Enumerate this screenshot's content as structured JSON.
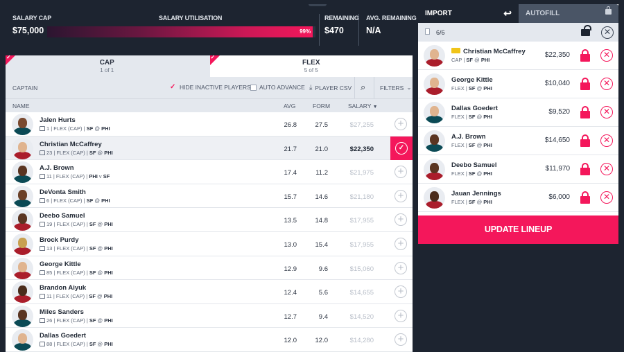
{
  "header": {
    "salary_cap_label": "SALARY CAP",
    "salary_cap_value": "$75,000",
    "utilisation_label": "SALARY UTILISATION",
    "utilisation_pct_text": "99%",
    "utilisation_fraction": 0.99,
    "remaining_label": "REMAINING",
    "remaining_value": "$470",
    "avg_remaining_label": "AVG. REMAINING",
    "avg_remaining_value": "N/A"
  },
  "tabs": {
    "cap": {
      "title": "CAP",
      "sub": "1 of 1"
    },
    "flex": {
      "title": "FLEX",
      "sub": "5 of 5"
    }
  },
  "toolbar": {
    "captain": "CAPTAIN",
    "hide_inactive": "HIDE INACTIVE PLAYERS",
    "auto_advance": "AUTO ADVANCE",
    "player_csv": "PLAYER CSV",
    "filters": "FILTERS"
  },
  "columns": {
    "name": "NAME",
    "avg": "AVG",
    "form": "FORM",
    "salary": "SALARY"
  },
  "players": [
    {
      "name": "Jalen Hurts",
      "num": "1",
      "pos": "FLEX (CAP)",
      "team": "SF",
      "at": "@",
      "opp": "PHI",
      "avg": "26.8",
      "form": "27.5",
      "salary": "$27,255",
      "selected": false,
      "jersey": "#0b4a55",
      "skin": "#7a4a30"
    },
    {
      "name": "Christian McCaffrey",
      "num": "23",
      "pos": "FLEX (CAP)",
      "team": "SF",
      "at": "@",
      "opp": "PHI",
      "avg": "21.7",
      "form": "21.0",
      "salary": "$22,350",
      "selected": true,
      "jersey": "#aa1d2b",
      "skin": "#e0b48f"
    },
    {
      "name": "A.J. Brown",
      "num": "11",
      "pos": "FLEX (CAP)",
      "team": "PHI",
      "at": "v",
      "opp": "SF",
      "avg": "17.4",
      "form": "11.2",
      "salary": "$21,975",
      "selected": false,
      "jersey": "#0b4a55",
      "skin": "#5a3522"
    },
    {
      "name": "DeVonta Smith",
      "num": "6",
      "pos": "FLEX (CAP)",
      "team": "SF",
      "at": "@",
      "opp": "PHI",
      "avg": "15.7",
      "form": "14.6",
      "salary": "$21,180",
      "selected": false,
      "jersey": "#0b4a55",
      "skin": "#6b4028"
    },
    {
      "name": "Deebo Samuel",
      "num": "19",
      "pos": "FLEX (CAP)",
      "team": "SF",
      "at": "@",
      "opp": "PHI",
      "avg": "13.5",
      "form": "14.8",
      "salary": "$17,955",
      "selected": false,
      "jersey": "#aa1d2b",
      "skin": "#5a3522"
    },
    {
      "name": "Brock Purdy",
      "num": "13",
      "pos": "FLEX (CAP)",
      "team": "SF",
      "at": "@",
      "opp": "PHI",
      "avg": "13.0",
      "form": "15.4",
      "salary": "$17,955",
      "selected": false,
      "jersey": "#aa1d2b",
      "skin": "#c8a050"
    },
    {
      "name": "George Kittle",
      "num": "85",
      "pos": "FLEX (CAP)",
      "team": "SF",
      "at": "@",
      "opp": "PHI",
      "avg": "12.9",
      "form": "9.6",
      "salary": "$15,060",
      "selected": false,
      "jersey": "#aa1d2b",
      "skin": "#e0b48f"
    },
    {
      "name": "Brandon Aiyuk",
      "num": "11",
      "pos": "FLEX (CAP)",
      "team": "SF",
      "at": "@",
      "opp": "PHI",
      "avg": "12.4",
      "form": "5.6",
      "salary": "$14,655",
      "selected": false,
      "jersey": "#aa1d2b",
      "skin": "#4a2c1c"
    },
    {
      "name": "Miles Sanders",
      "num": "26",
      "pos": "FLEX (CAP)",
      "team": "SF",
      "at": "@",
      "opp": "PHI",
      "avg": "12.7",
      "form": "9.4",
      "salary": "$14,520",
      "selected": false,
      "jersey": "#0b4a55",
      "skin": "#5a3522"
    },
    {
      "name": "Dallas Goedert",
      "num": "88",
      "pos": "FLEX (CAP)",
      "team": "SF",
      "at": "@",
      "opp": "PHI",
      "avg": "12.0",
      "form": "12.0",
      "salary": "$14,280",
      "selected": false,
      "jersey": "#0b4a55",
      "skin": "#e0b48f"
    }
  ],
  "right": {
    "import_label": "IMPORT",
    "autofill_label": "AUTOFILL",
    "count": "6/6",
    "lineup": [
      {
        "name": "Christian McCaffrey",
        "slot": "CAP",
        "team": "SF",
        "at": "@",
        "opp": "PHI",
        "salary": "$22,350",
        "captain": true,
        "jersey": "#aa1d2b",
        "skin": "#e0b48f"
      },
      {
        "name": "George Kittle",
        "slot": "FLEX",
        "team": "SF",
        "at": "@",
        "opp": "PHI",
        "salary": "$10,040",
        "captain": false,
        "jersey": "#aa1d2b",
        "skin": "#e0b48f"
      },
      {
        "name": "Dallas Goedert",
        "slot": "FLEX",
        "team": "SF",
        "at": "@",
        "opp": "PHI",
        "salary": "$9,520",
        "captain": false,
        "jersey": "#0b4a55",
        "skin": "#e0b48f"
      },
      {
        "name": "A.J. Brown",
        "slot": "FLEX",
        "team": "SF",
        "at": "@",
        "opp": "PHI",
        "salary": "$14,650",
        "captain": false,
        "jersey": "#0b4a55",
        "skin": "#5a3522"
      },
      {
        "name": "Deebo Samuel",
        "slot": "FLEX",
        "team": "SF",
        "at": "@",
        "opp": "PHI",
        "salary": "$11,970",
        "captain": false,
        "jersey": "#aa1d2b",
        "skin": "#5a3522"
      },
      {
        "name": "Jauan Jennings",
        "slot": "FLEX",
        "team": "SF",
        "at": "@",
        "opp": "PHI",
        "salary": "$6,000",
        "captain": false,
        "jersey": "#aa1d2b",
        "skin": "#4a2c1c"
      }
    ],
    "update_label": "UPDATE LINEUP"
  },
  "colors": {
    "accent": "#f4175b",
    "dark": "#1d2430",
    "panel_grey": "#e4e8ee"
  }
}
